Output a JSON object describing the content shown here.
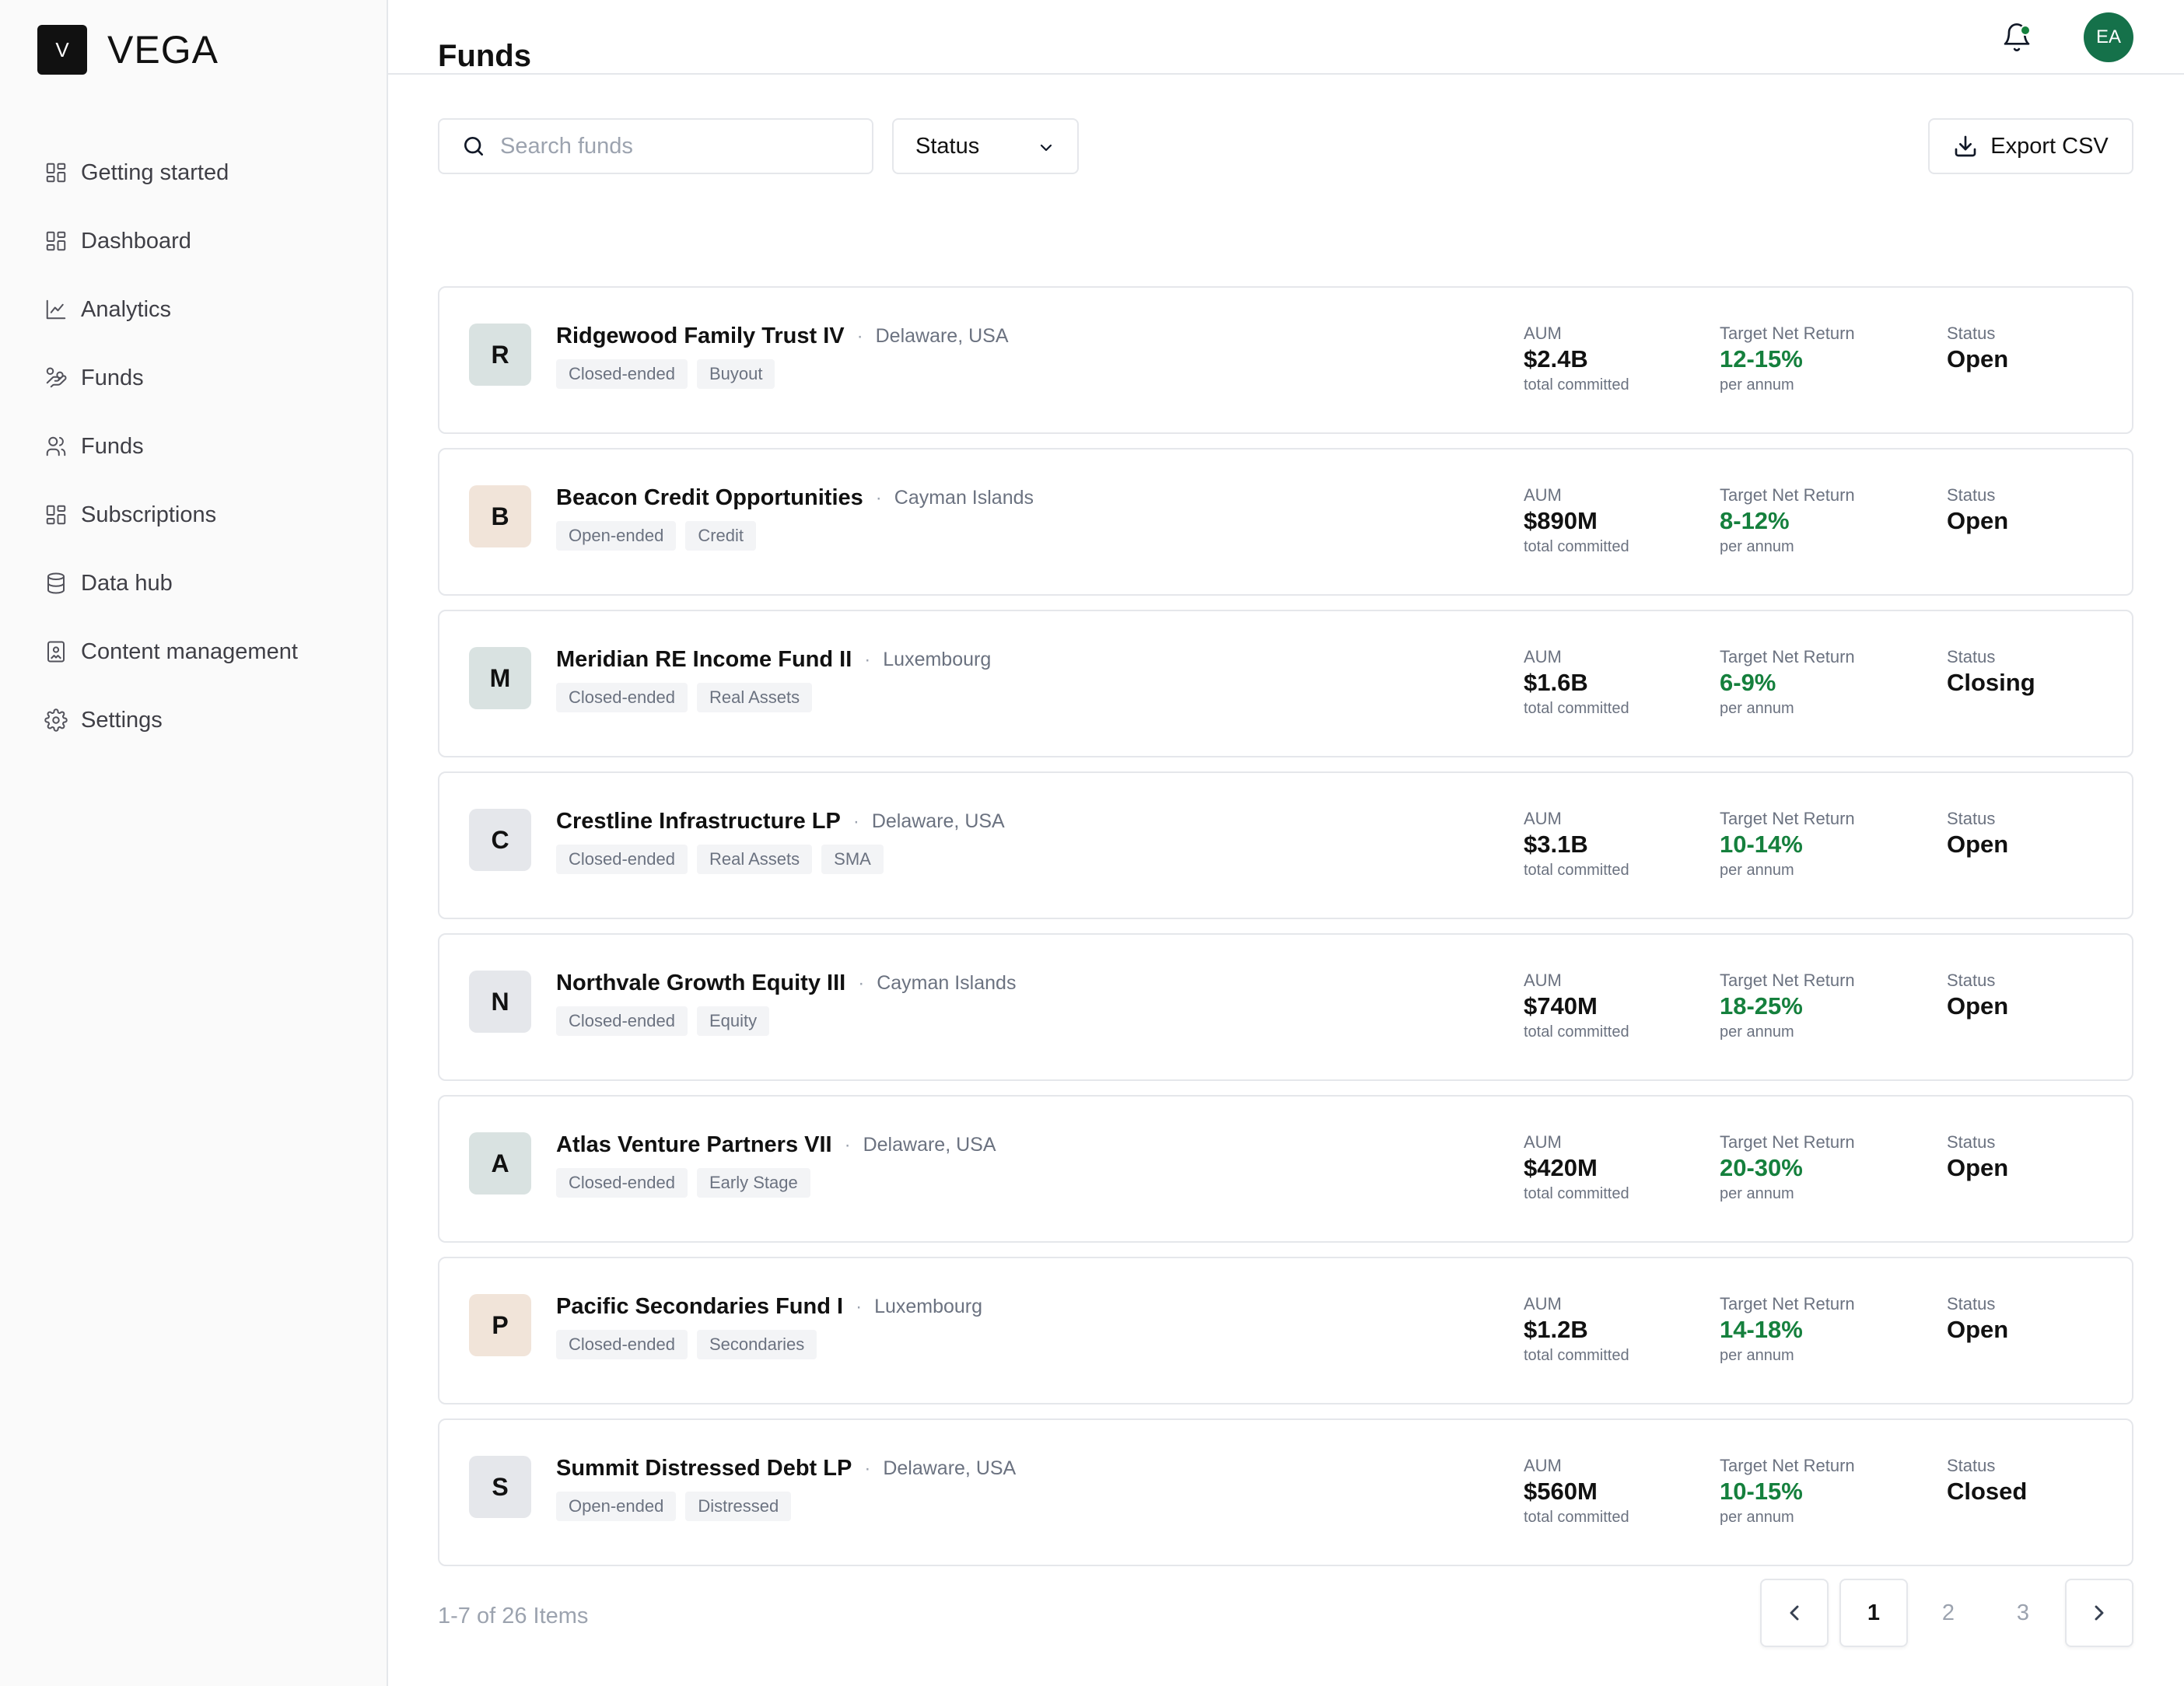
{
  "brand": {
    "logo_letter": "V",
    "name": "VEGA"
  },
  "sidebar": {
    "items": [
      {
        "label": "Getting started",
        "icon": "grid-icon"
      },
      {
        "label": "Dashboard",
        "icon": "grid-icon"
      },
      {
        "label": "Analytics",
        "icon": "line-chart-icon"
      },
      {
        "label": "Funds",
        "icon": "hand-coins-icon"
      },
      {
        "label": "Funds",
        "icon": "users-icon"
      },
      {
        "label": "Subscriptions",
        "icon": "grid-icon"
      },
      {
        "label": "Data hub",
        "icon": "database-icon"
      },
      {
        "label": "Content management",
        "icon": "image-file-icon"
      },
      {
        "label": "Settings",
        "icon": "gear-icon"
      }
    ]
  },
  "header": {
    "avatar_initials": "EA",
    "avatar_color": "#15714a",
    "notification_dot_color": "#15803d"
  },
  "page": {
    "title": "Funds"
  },
  "toolbar": {
    "search_placeholder": "Search funds",
    "status_label": "Status",
    "export_label": "Export CSV"
  },
  "labels": {
    "aum": "AUM",
    "aum_sub": "total committed",
    "return": "Target Net Return",
    "return_sub": "per annum",
    "status": "Status"
  },
  "funds": [
    {
      "initial": "R",
      "badge_color": "#d9e2e1",
      "name": "Ridgewood Family Trust IV",
      "location": "Delaware, USA",
      "tags": [
        "Closed-ended",
        "Buyout"
      ],
      "aum": "$2.4B",
      "return": "12-15%",
      "status": "Open"
    },
    {
      "initial": "B",
      "badge_color": "#f1e4d9",
      "name": "Beacon Credit Opportunities",
      "location": "Cayman Islands",
      "tags": [
        "Open-ended",
        "Credit"
      ],
      "aum": "$890M",
      "return": "8-12%",
      "status": "Open"
    },
    {
      "initial": "M",
      "badge_color": "#d9e2e1",
      "name": "Meridian RE Income Fund II",
      "location": "Luxembourg",
      "tags": [
        "Closed-ended",
        "Real Assets"
      ],
      "aum": "$1.6B",
      "return": "6-9%",
      "status": "Closing"
    },
    {
      "initial": "C",
      "badge_color": "#e5e7eb",
      "name": "Crestline Infrastructure LP",
      "location": "Delaware, USA",
      "tags": [
        "Closed-ended",
        "Real Assets",
        "SMA"
      ],
      "aum": "$3.1B",
      "return": "10-14%",
      "status": "Open"
    },
    {
      "initial": "N",
      "badge_color": "#e5e7eb",
      "name": "Northvale Growth Equity III",
      "location": "Cayman Islands",
      "tags": [
        "Closed-ended",
        "Equity"
      ],
      "aum": "$740M",
      "return": "18-25%",
      "status": "Open"
    },
    {
      "initial": "A",
      "badge_color": "#d9e2e1",
      "name": "Atlas Venture Partners VII",
      "location": "Delaware, USA",
      "tags": [
        "Closed-ended",
        "Early Stage"
      ],
      "aum": "$420M",
      "return": "20-30%",
      "status": "Open"
    },
    {
      "initial": "P",
      "badge_color": "#f1e4d9",
      "name": "Pacific Secondaries Fund I",
      "location": "Luxembourg",
      "tags": [
        "Closed-ended",
        "Secondaries"
      ],
      "aum": "$1.2B",
      "return": "14-18%",
      "status": "Open"
    },
    {
      "initial": "S",
      "badge_color": "#e5e7eb",
      "name": "Summit Distressed Debt LP",
      "location": "Delaware, USA",
      "tags": [
        "Open-ended",
        "Distressed"
      ],
      "aum": "$560M",
      "return": "10-15%",
      "status": "Closed"
    }
  ],
  "pagination": {
    "summary": "1-7 of 26 Items",
    "pages": [
      "1",
      "2",
      "3"
    ],
    "current": "1"
  },
  "colors": {
    "return_green": "#15803d",
    "brand_dark": "#111111"
  }
}
